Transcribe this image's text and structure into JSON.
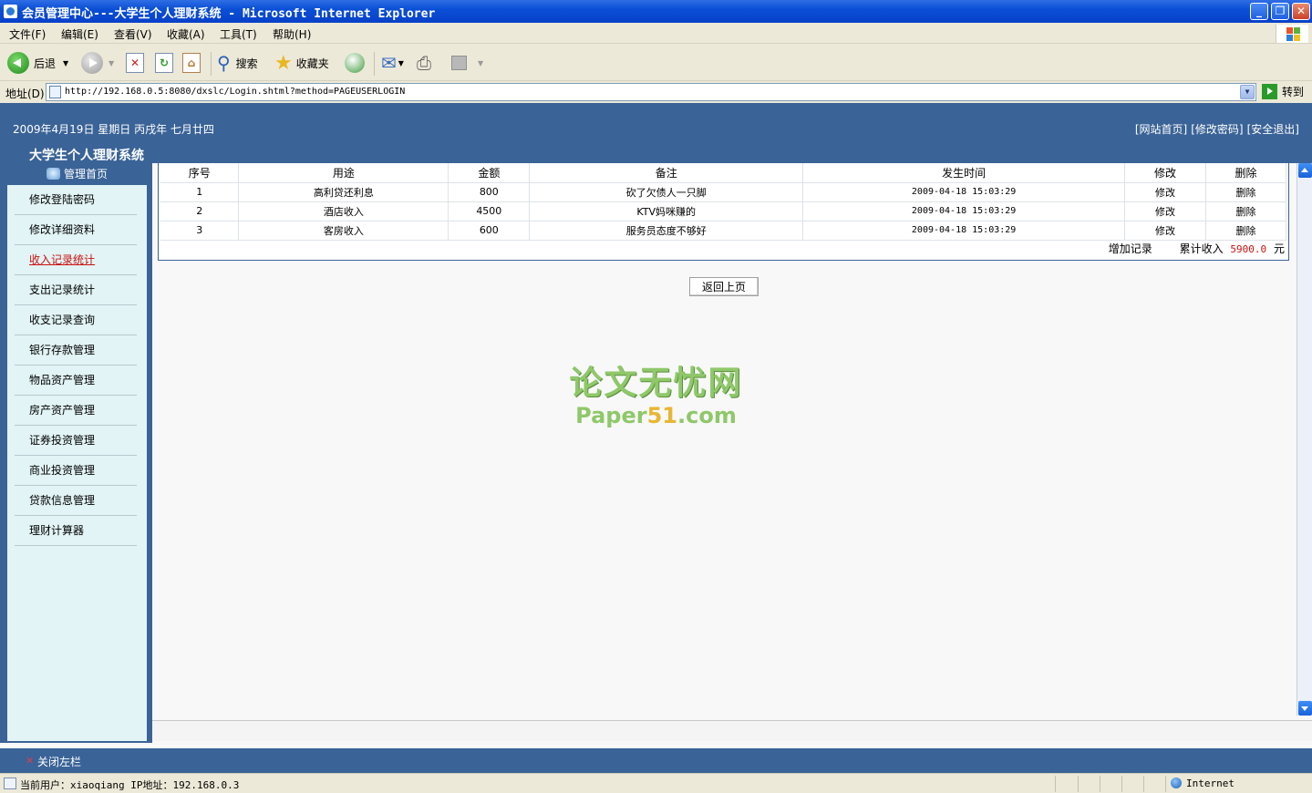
{
  "window": {
    "title": "会员管理中心---大学生个人理财系统 - Microsoft Internet Explorer",
    "minimize": "_",
    "restore": "❐",
    "close": "✕"
  },
  "menubar": [
    "文件(F)",
    "编辑(E)",
    "查看(V)",
    "收藏(A)",
    "工具(T)",
    "帮助(H)"
  ],
  "toolbar": {
    "back": "后退",
    "search": "搜索",
    "favorites": "收藏夹"
  },
  "address": {
    "label": "地址(D)",
    "url": "http://192.168.0.5:8080/dxslc/Login.shtml?method=PAGEUSERLOGIN",
    "go": "转到"
  },
  "header": {
    "date": "2009年4月19日 星期日 丙戌年 七月廿四",
    "links": [
      "[网站首页]",
      "[修改密码]",
      "[安全退出]"
    ],
    "system_name": "大学生个人理财系统"
  },
  "sidebar": {
    "title": "管理首页",
    "items": [
      {
        "label": "修改登陆密码",
        "active": false
      },
      {
        "label": "修改详细资料",
        "active": false
      },
      {
        "label": "收入记录统计",
        "active": true
      },
      {
        "label": "支出记录统计",
        "active": false
      },
      {
        "label": "收支记录查询",
        "active": false
      },
      {
        "label": "银行存款管理",
        "active": false
      },
      {
        "label": "物品资产管理",
        "active": false
      },
      {
        "label": "房产资产管理",
        "active": false
      },
      {
        "label": "证券投资管理",
        "active": false
      },
      {
        "label": "商业投资管理",
        "active": false
      },
      {
        "label": "贷款信息管理",
        "active": false
      },
      {
        "label": "理财计算器",
        "active": false
      }
    ]
  },
  "table": {
    "headers": [
      "序号",
      "用途",
      "金额",
      "备注",
      "发生时间",
      "修改",
      "删除"
    ],
    "rows": [
      [
        "1",
        "高利贷还利息",
        "800",
        "砍了欠债人一只脚",
        "2009-04-18 15:03:29",
        "修改",
        "删除"
      ],
      [
        "2",
        "酒店收入",
        "4500",
        "KTV妈咪赚的",
        "2009-04-18 15:03:29",
        "修改",
        "删除"
      ],
      [
        "3",
        "客房收入",
        "600",
        "服务员态度不够好",
        "2009-04-18 15:03:29",
        "修改",
        "删除"
      ]
    ],
    "add_record": "增加记录",
    "total_label": "累计收入",
    "total_value": "5900.0",
    "total_unit": "元"
  },
  "back_button": "返回上页",
  "watermark": {
    "cn": "论文无忧网",
    "en_prefix": "Paper",
    "en_num": "51",
    "en_suffix": ".com"
  },
  "footer": {
    "close_sidebar": "关闭左栏"
  },
  "status": {
    "text": "当前用户：xiaoqiang  IP地址：192.168.0.3",
    "zone": "Internet"
  }
}
